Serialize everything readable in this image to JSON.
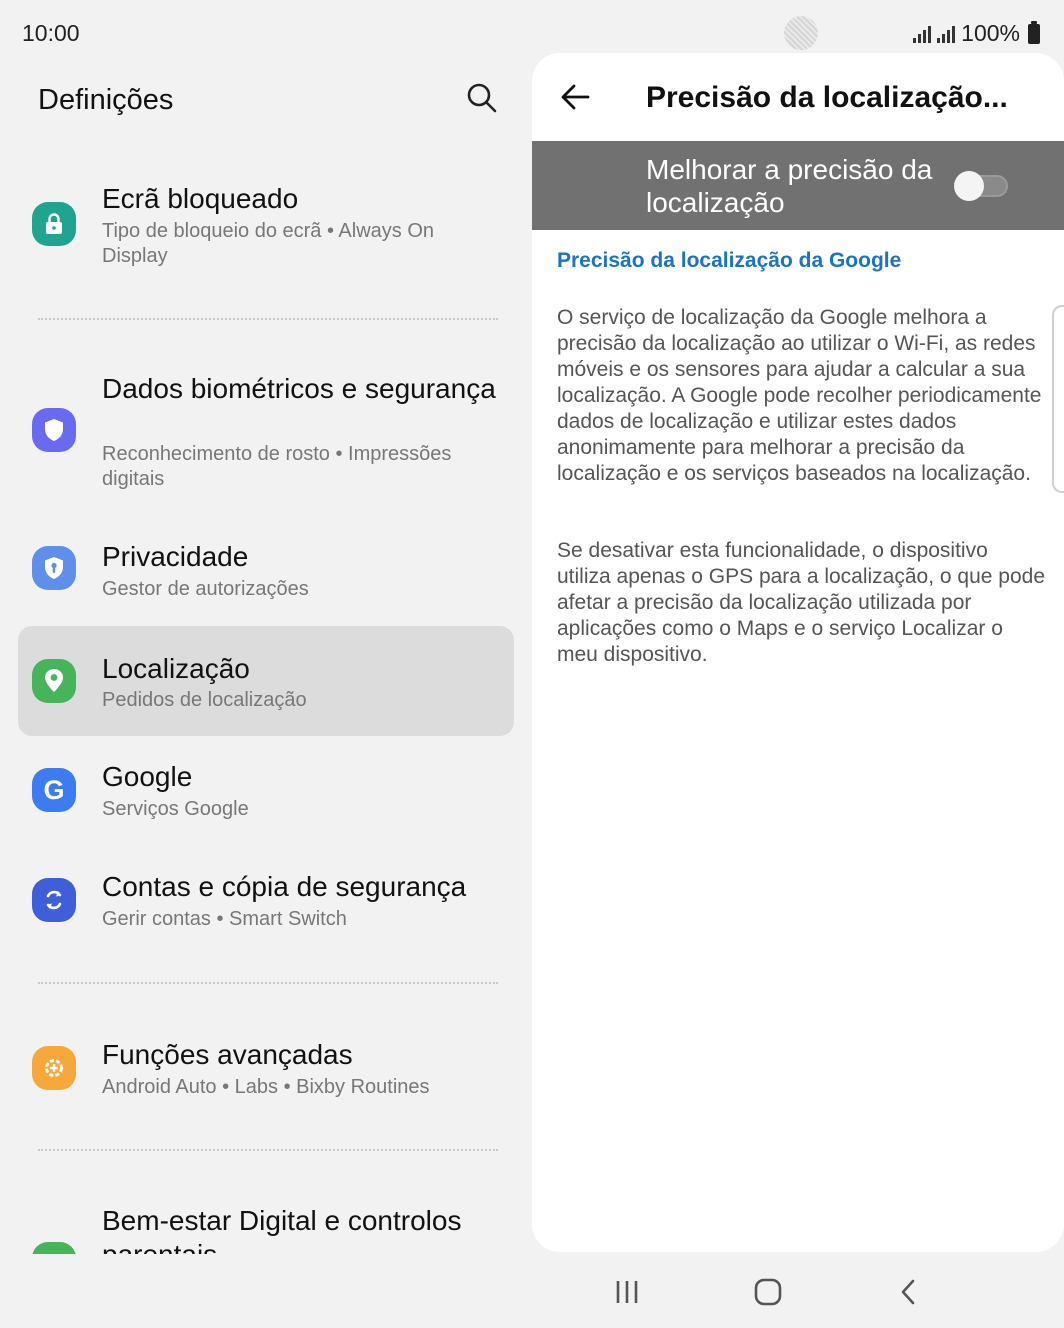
{
  "status_bar": {
    "time": "10:00",
    "battery": "100%"
  },
  "left_pane": {
    "title": "Definições",
    "items": [
      {
        "title": "Ecrã bloqueado",
        "subtitle": "Tipo de bloqueio do ecrã  •  Always On Display",
        "icon": "lock-icon",
        "color": "#1fa58f"
      },
      {
        "title": "Dados biométricos e segurança",
        "subtitle": "Reconhecimento de rosto  •  Impressões digitais",
        "icon": "shield-icon",
        "color": "#6a6af0"
      },
      {
        "title": "Privacidade",
        "subtitle": "Gestor de autorizações",
        "icon": "privacy-shield-icon",
        "color": "#5f8fe8"
      },
      {
        "title": "Localização",
        "subtitle": "Pedidos de localização",
        "icon": "location-pin-icon",
        "color": "#46b45a"
      },
      {
        "title": "Google",
        "subtitle": "Serviços Google",
        "icon": "google-icon",
        "color": "#3d7cf0"
      },
      {
        "title": "Contas e cópia de segurança",
        "subtitle": "Gerir contas  •  Smart Switch",
        "icon": "sync-icon",
        "color": "#3e5fd8"
      },
      {
        "title": "Funções avançadas",
        "subtitle": "Android Auto  •  Labs  •  Bixby Routines",
        "icon": "gear-plus-icon",
        "color": "#f6a93a"
      },
      {
        "title": "Bem-estar Digital e controlos parentais",
        "icon": "wellbeing-icon",
        "color": "#46b45a"
      }
    ]
  },
  "right_pane": {
    "title": "Precisão da localização...",
    "toggle": {
      "label": "Melhorar a precisão da localização",
      "state": "off"
    },
    "section_link": "Precisão da localização da Google",
    "paragraph_1": "O serviço de localização da Google melhora a precisão da localização ao utilizar o Wi-Fi, as redes móveis e os sensores para ajudar a calcular a sua localização. A Google pode recolher periodicamente dados de localização e utilizar estes dados anonimamente para melhorar a precisão da localização e os serviços baseados na localização.",
    "paragraph_2": "Se desativar esta funcionalidade, o dispositivo utiliza apenas o GPS para a localização, o que pode afetar a precisão da localização utilizada por aplicações como o Maps e o serviço Localizar o meu dispositivo."
  },
  "nav_bar": {
    "buttons": [
      "recents-icon",
      "home-icon",
      "back-icon"
    ]
  }
}
